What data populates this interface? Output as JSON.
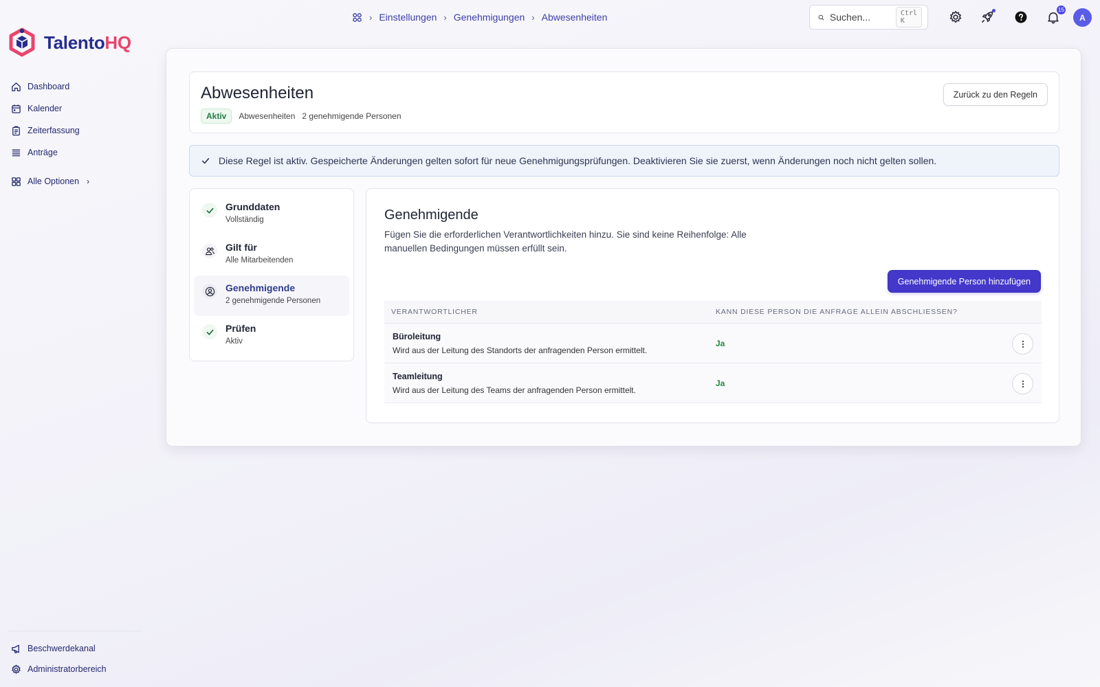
{
  "app": {
    "logo_part1": "Talento",
    "logo_part2": "HQ",
    "brand_colors": {
      "primary": "#262d8c",
      "accent": "#e9456b",
      "action": "#4338ca"
    }
  },
  "sidebar": {
    "items": [
      {
        "label": "Dashboard",
        "icon": "home-icon"
      },
      {
        "label": "Kalender",
        "icon": "calendar-icon"
      },
      {
        "label": "Zeiterfassung",
        "icon": "clipboard-icon"
      },
      {
        "label": "Anträge",
        "icon": "stack-icon"
      }
    ],
    "all_options": "Alle Optionen",
    "bottom": [
      {
        "label": "Beschwerdekanal",
        "icon": "megaphone-icon"
      },
      {
        "label": "Administratorbereich",
        "icon": "gear-icon"
      }
    ]
  },
  "topbar": {
    "breadcrumb": [
      "Einstellungen",
      "Genehmigungen",
      "Abwesenheiten"
    ],
    "search_placeholder": "Suchen...",
    "search_shortcut": "Ctrl K",
    "notification_count": "15",
    "avatar_initial": "A"
  },
  "header": {
    "title": "Abwesenheiten",
    "status": "Aktiv",
    "category": "Abwesenheiten",
    "approver_count": "2 genehmigende Personen",
    "back_button": "Zurück zu den Regeln"
  },
  "alert": {
    "text": "Diese Regel ist aktiv. Gespeicherte Änderungen gelten sofort für neue Genehmigungsprüfungen. Deaktivieren Sie sie zuerst, wenn Änderungen noch nicht gelten sollen."
  },
  "steps": [
    {
      "title": "Grunddaten",
      "subtitle": "Vollständig"
    },
    {
      "title": "Gilt für",
      "subtitle": "Alle Mitarbeitenden"
    },
    {
      "title": "Genehmigende",
      "subtitle": "2 genehmigende Personen"
    },
    {
      "title": "Prüfen",
      "subtitle": "Aktiv"
    }
  ],
  "content": {
    "title": "Genehmigende",
    "description": "Fügen Sie die erforderlichen Verantwortlichkeiten hinzu. Sie sind keine Reihenfolge: Alle manuellen Bedingungen müssen erfüllt sein.",
    "add_button": "Genehmigende Person hinzufügen",
    "table": {
      "headers": [
        "VERANTWORTLICHER",
        "KANN DIESE PERSON DIE ANFRAGE ALLEIN ABSCHLIESSEN?"
      ],
      "rows": [
        {
          "title": "Büroleitung",
          "subtitle": "Wird aus der Leitung des Standorts der anfragenden Person ermittelt.",
          "value": "Ja"
        },
        {
          "title": "Teamleitung",
          "subtitle": "Wird aus der Leitung des Teams der anfragenden Person ermittelt.",
          "value": "Ja"
        }
      ]
    }
  }
}
